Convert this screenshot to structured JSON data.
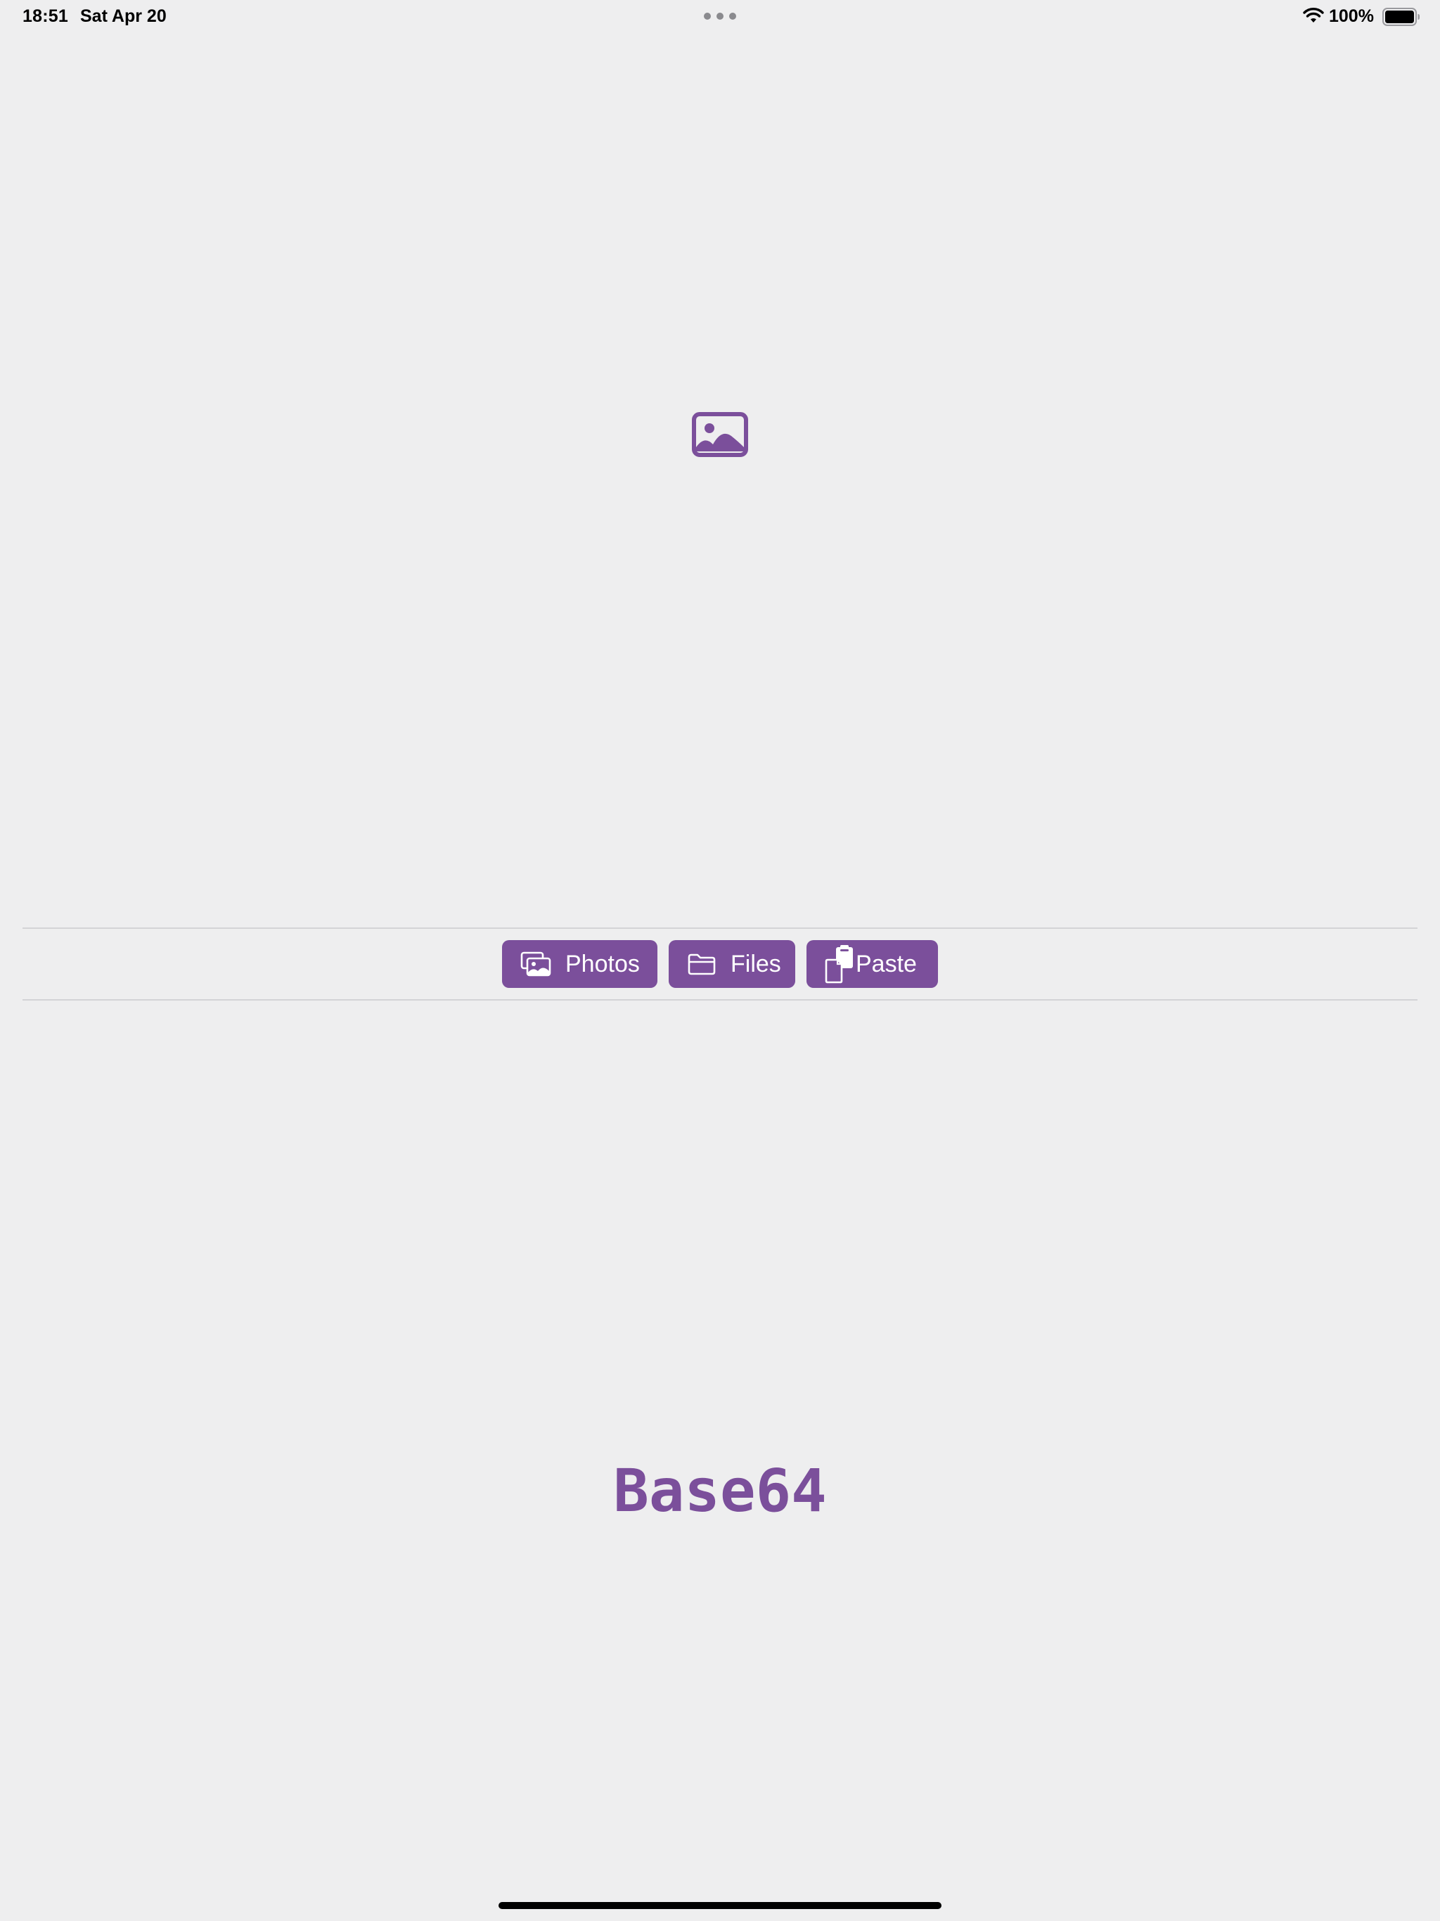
{
  "status_bar": {
    "time": "18:51",
    "date": "Sat Apr 20",
    "battery_percent": "100%",
    "battery_level": 1.0,
    "icons": [
      "multitask-dots-icon",
      "wifi-icon",
      "battery-icon"
    ]
  },
  "main": {
    "placeholder_icon": "photo-icon",
    "title": "Base64"
  },
  "toolbar": {
    "buttons": [
      {
        "label": "Photos",
        "icon": "photo-stack-icon"
      },
      {
        "label": "Files",
        "icon": "folder-icon"
      },
      {
        "label": "Paste",
        "icon": "clipboard-icon"
      }
    ]
  },
  "colors": {
    "accent": "#7b4f9b",
    "background": "#eeeeef",
    "divider": "#d3d3d6"
  }
}
